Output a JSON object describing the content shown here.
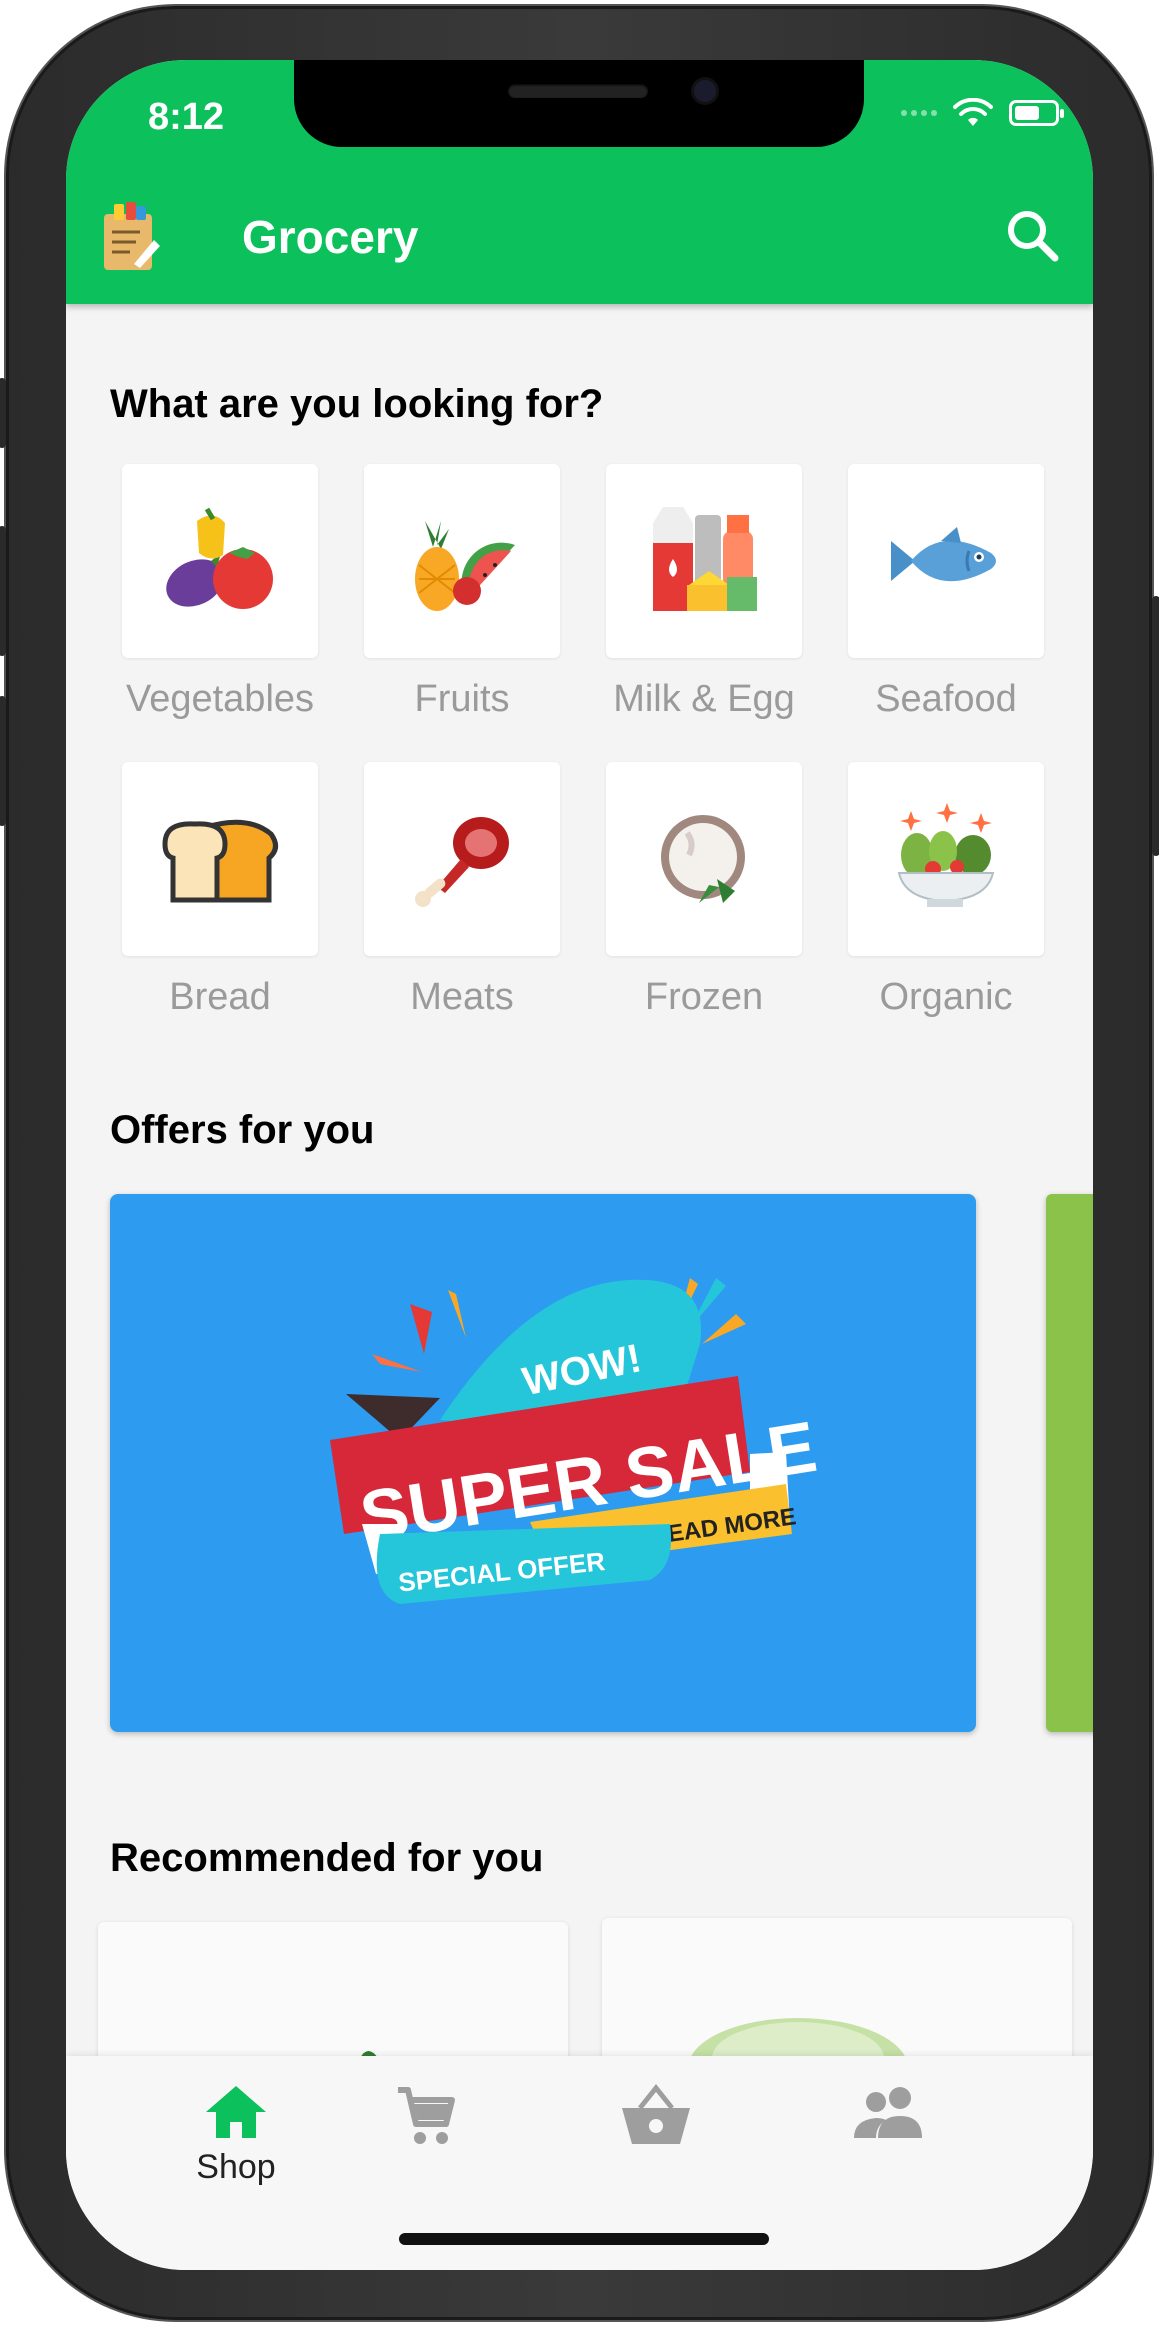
{
  "status_bar": {
    "time": "8:12"
  },
  "app_bar": {
    "title": "Grocery"
  },
  "categories_section": {
    "title": "What are you looking for?",
    "items": [
      {
        "label": "Vegetables",
        "icon": "vegetables-icon"
      },
      {
        "label": "Fruits",
        "icon": "fruits-icon"
      },
      {
        "label": "Milk & Egg",
        "icon": "milk-egg-icon"
      },
      {
        "label": "Seafood",
        "icon": "fish-icon"
      },
      {
        "label": "Bread",
        "icon": "bread-icon"
      },
      {
        "label": "Meats",
        "icon": "meat-icon"
      },
      {
        "label": "Frozen",
        "icon": "frozen-icon"
      },
      {
        "label": "Organic",
        "icon": "salad-icon"
      }
    ]
  },
  "offers_section": {
    "title": "Offers for you",
    "banner": {
      "wow": "WOW!",
      "headline": "SUPER SALE",
      "read_more": "READ MORE",
      "special": "SPECIAL OFFER"
    }
  },
  "recommended_section": {
    "title": "Recommended for you"
  },
  "bottom_nav": {
    "items": [
      {
        "label": "Shop",
        "icon": "home-icon",
        "active": true
      },
      {
        "label": "",
        "icon": "cart-icon",
        "active": false
      },
      {
        "label": "",
        "icon": "basket-icon",
        "active": false
      },
      {
        "label": "",
        "icon": "people-icon",
        "active": false
      }
    ]
  },
  "colors": {
    "primary": "#0cc15b",
    "offer_blue": "#2d9bf0",
    "inactive_icon": "#9e9e9e"
  }
}
